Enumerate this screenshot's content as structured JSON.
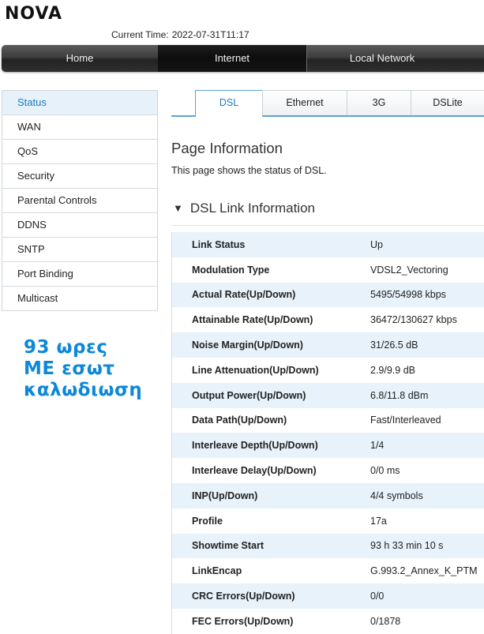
{
  "brand": "NOVA",
  "header": {
    "current_time_label": "Current Time:",
    "current_time_value": "2022-07-31T11:17"
  },
  "nav": {
    "items": [
      {
        "label": "Home"
      },
      {
        "label": "Internet",
        "active": true
      },
      {
        "label": "Local Network"
      }
    ]
  },
  "sidebar": {
    "items": [
      {
        "label": "Status",
        "active": true
      },
      {
        "label": "WAN"
      },
      {
        "label": "QoS"
      },
      {
        "label": "Security"
      },
      {
        "label": "Parental Controls"
      },
      {
        "label": "DDNS"
      },
      {
        "label": "SNTP"
      },
      {
        "label": "Port Binding"
      },
      {
        "label": "Multicast"
      }
    ]
  },
  "overlay_note": {
    "line1": "93 ωρες",
    "line2": "ΜΕ εσωτ",
    "line3": "καλωδιωση"
  },
  "tabs": [
    {
      "label": "DSL",
      "active": true
    },
    {
      "label": "Ethernet"
    },
    {
      "label": "3G"
    },
    {
      "label": "DSLite"
    }
  ],
  "page": {
    "title": "Page Information",
    "description": "This page shows the status of DSL.",
    "section_title": "DSL Link Information"
  },
  "dsl_info": [
    {
      "label": "Link Status",
      "value": "Up"
    },
    {
      "label": "Modulation Type",
      "value": "VDSL2_Vectoring"
    },
    {
      "label": "Actual Rate(Up/Down)",
      "value": "5495/54998 kbps"
    },
    {
      "label": "Attainable Rate(Up/Down)",
      "value": "36472/130627 kbps"
    },
    {
      "label": "Noise Margin(Up/Down)",
      "value": "31/26.5 dB"
    },
    {
      "label": "Line Attenuation(Up/Down)",
      "value": "2.9/9.9 dB"
    },
    {
      "label": "Output Power(Up/Down)",
      "value": "6.8/11.8 dBm"
    },
    {
      "label": "Data Path(Up/Down)",
      "value": "Fast/Interleaved"
    },
    {
      "label": "Interleave Depth(Up/Down)",
      "value": "1/4"
    },
    {
      "label": "Interleave Delay(Up/Down)",
      "value": "0/0 ms"
    },
    {
      "label": "INP(Up/Down)",
      "value": "4/4 symbols"
    },
    {
      "label": "Profile",
      "value": "17a"
    },
    {
      "label": "Showtime Start",
      "value": "93 h 33 min 10 s"
    },
    {
      "label": "LinkEncap",
      "value": "G.993.2_Annex_K_PTM"
    },
    {
      "label": "CRC Errors(Up/Down)",
      "value": "0/0"
    },
    {
      "label": "FEC Errors(Up/Down)",
      "value": "0/1878"
    }
  ],
  "colors": {
    "accent_blue": "#1a7cc0",
    "note_blue": "#0d88d8",
    "row_tint": "#e8f2fa",
    "nav_dark": "#2f2f2f"
  }
}
